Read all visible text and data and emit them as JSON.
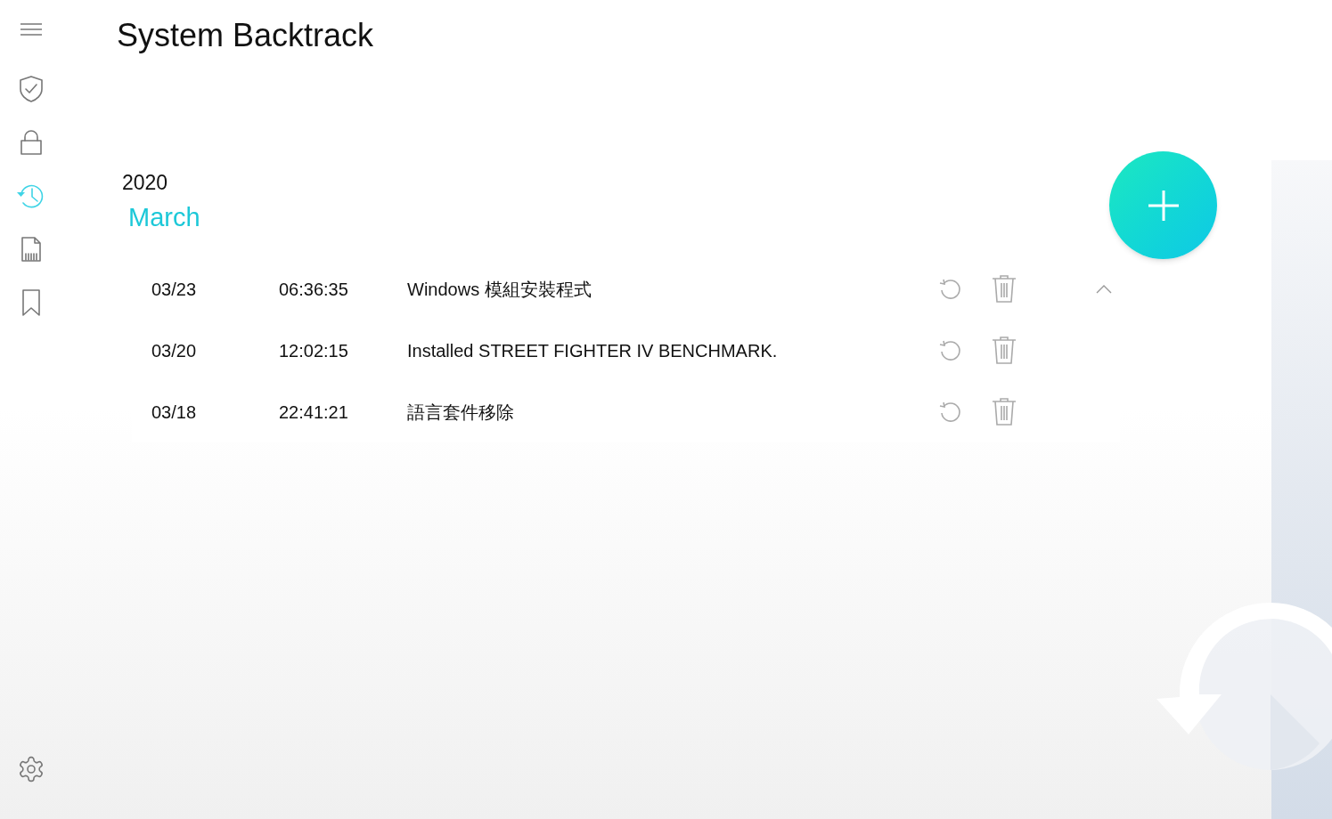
{
  "sidebar": {
    "items": [
      {
        "kind": "shield",
        "selected": false
      },
      {
        "kind": "lock",
        "selected": false
      },
      {
        "kind": "history",
        "selected": true
      },
      {
        "kind": "file",
        "selected": false
      },
      {
        "kind": "bookmark",
        "selected": false
      }
    ]
  },
  "title": "System Backtrack",
  "year": "2020",
  "month": "March",
  "records": [
    {
      "date": "03/23",
      "time": "06:36:35",
      "description": "Windows 模組安裝程式",
      "expanded": true
    },
    {
      "date": "03/20",
      "time": "12:02:15",
      "description": "Installed STREET FIGHTER IV BENCHMARK.",
      "expanded": false
    },
    {
      "date": "03/18",
      "time": "22:41:21",
      "description": "語言套件移除",
      "expanded": false
    }
  ]
}
